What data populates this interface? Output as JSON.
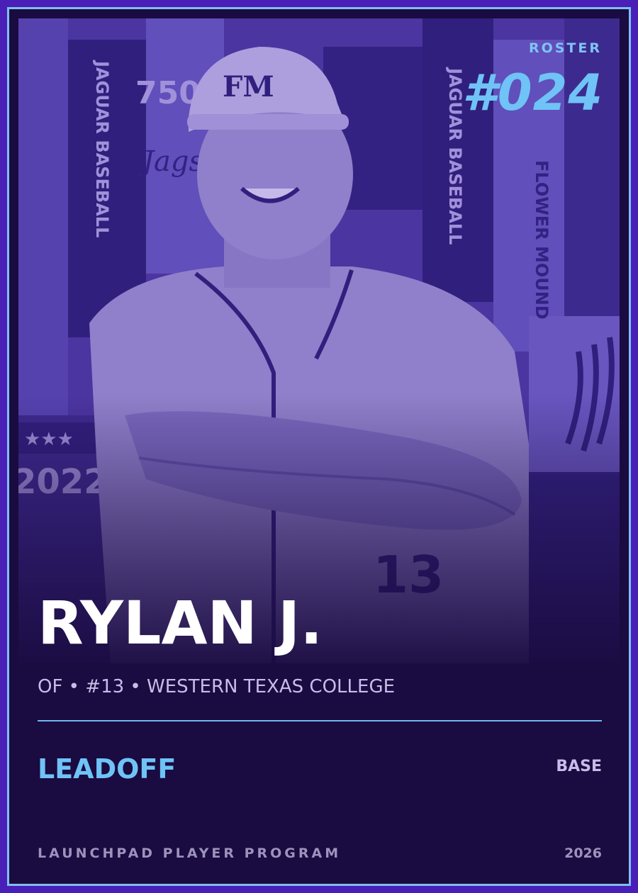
{
  "card": {
    "roster_label": "ROSTER",
    "roster_number": "#024",
    "player_name": "RYLAN J.",
    "meta": "OF • #13 • WESTERN TEXAS COLLEGE",
    "tier": "LEADOFF",
    "variant": "BASE",
    "program": "LAUNCHPAD PLAYER PROGRAM",
    "year": "2026"
  },
  "photo": {
    "backdrop_texts": [
      "JAGUAR BASEBALL",
      "FLOWER MOUND",
      "750",
      "2022",
      "Jags"
    ],
    "cap_text": "FM",
    "jersey_number": "13"
  },
  "colors": {
    "frame": "#4a1fb8",
    "border": "#7fbfee",
    "background": "#1a0b40",
    "accent": "#6fc3f6",
    "text_muted": "#c8bce8"
  }
}
